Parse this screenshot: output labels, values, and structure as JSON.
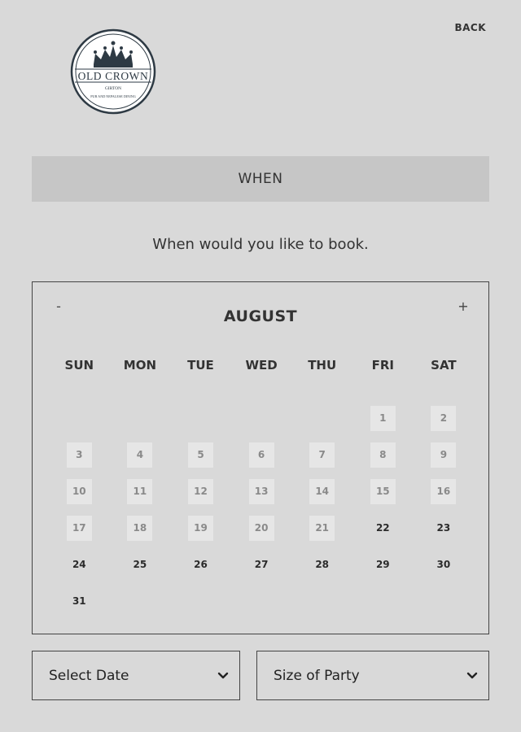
{
  "nav": {
    "back_label": "BACK"
  },
  "logo": {
    "name": "OLD CROWN",
    "subtitle": "GIRTON",
    "tagline": "PUB AND NEPALESE DINING"
  },
  "section": {
    "title": "WHEN"
  },
  "prompt": "When would you like to book.",
  "calendar": {
    "prev_label": "-",
    "next_label": "+",
    "month": "AUGUST",
    "weekdays": [
      "SUN",
      "MON",
      "TUE",
      "WED",
      "THU",
      "FRI",
      "SAT"
    ],
    "first_weekday_index": 5,
    "days_in_month": 31,
    "last_unavailable_day": 21
  },
  "selects": {
    "date_label": "Select Date",
    "party_label": "Size of Party"
  },
  "colors": {
    "background": "#d9d9d9",
    "header_bar": "#c6c6c6",
    "disabled_day_bg": "#e6e6e6",
    "text": "#333333"
  }
}
